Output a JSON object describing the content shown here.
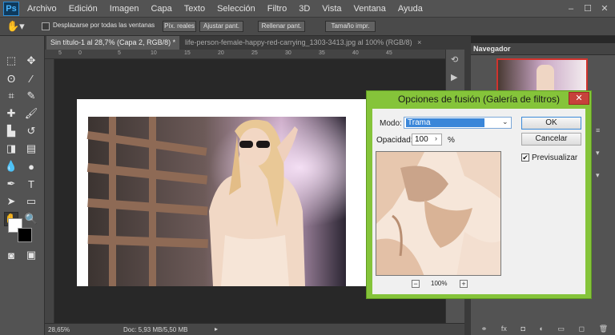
{
  "app": {
    "logo": "Ps"
  },
  "menu": [
    "Archivo",
    "Edición",
    "Imagen",
    "Capa",
    "Texto",
    "Selección",
    "Filtro",
    "3D",
    "Vista",
    "Ventana",
    "Ayuda"
  ],
  "window_controls": [
    "–",
    "☐",
    "✕"
  ],
  "options_bar": {
    "scroll_all_label": "Desplazarse por todas las ventanas",
    "buttons": [
      "Píx. reales",
      "Ajustar pant.",
      "Rellenar pant.",
      "Tamaño impr."
    ]
  },
  "tabs": [
    {
      "label": "Sin título-1 al 28,7% (Capa 2, RGB/8) *",
      "close": "×"
    },
    {
      "label": "life-person-female-happy-red-carrying_1303-3413.jpg al 100% (RGB/8)",
      "close": "×"
    }
  ],
  "ruler": {
    "top": [
      "5",
      "0",
      "5",
      "10",
      "15",
      "20",
      "25",
      "30",
      "35",
      "40",
      "45"
    ]
  },
  "status": {
    "zoom": "28,65%",
    "doc": "Doc: 5,93 MB/5,50 MB"
  },
  "navigator": {
    "title": "Navegador"
  },
  "dialog": {
    "title": "Opciones de fusión (Galería de filtros)",
    "close": "✕",
    "mode_label": "Modo:",
    "mode_value": "Trama",
    "opacity_label": "Opacidad:",
    "opacity_value": "100",
    "opacity_unit": "%",
    "ok": "OK",
    "cancel": "Cancelar",
    "preview_label": "Previsualizar",
    "preview_checked": "✔",
    "zoom_minus": "−",
    "zoom_value": "100%",
    "zoom_plus": "+"
  },
  "colors": {
    "accent": "#85c43a",
    "menubar": "#535353",
    "canvas_bg": "#282828",
    "close": "#c7423b"
  }
}
